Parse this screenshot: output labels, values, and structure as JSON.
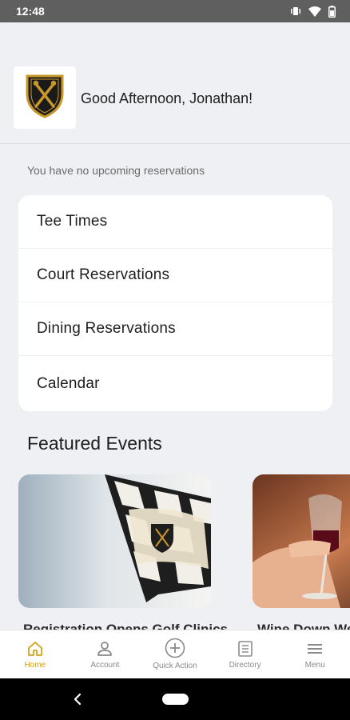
{
  "status_bar": {
    "time": "12:48"
  },
  "header": {
    "greeting": "Good Afternoon, Jonathan!",
    "logo_icon": "club-crest-icon",
    "brand_color": "#d4a017"
  },
  "reservations": {
    "empty_message": "You have no upcoming reservations",
    "items": [
      {
        "label": "Tee Times"
      },
      {
        "label": "Court Reservations"
      },
      {
        "label": "Dining Reservations"
      },
      {
        "label": "Calendar"
      }
    ]
  },
  "featured": {
    "title": "Featured Events",
    "events": [
      {
        "caption": "Registration Opens Golf Clinics",
        "image_icon": "checkered-flag-image"
      },
      {
        "caption": "Wine Down Wednesday",
        "image_icon": "wine-glasses-image"
      }
    ]
  },
  "bottom_nav": {
    "active_color": "#d4a017",
    "items": [
      {
        "label": "Home",
        "icon": "home-icon"
      },
      {
        "label": "Account",
        "icon": "person-icon"
      },
      {
        "label": "Quick Action",
        "icon": "plus-circle-icon"
      },
      {
        "label": "Directory",
        "icon": "list-book-icon"
      },
      {
        "label": "Menu",
        "icon": "hamburger-icon"
      }
    ]
  }
}
